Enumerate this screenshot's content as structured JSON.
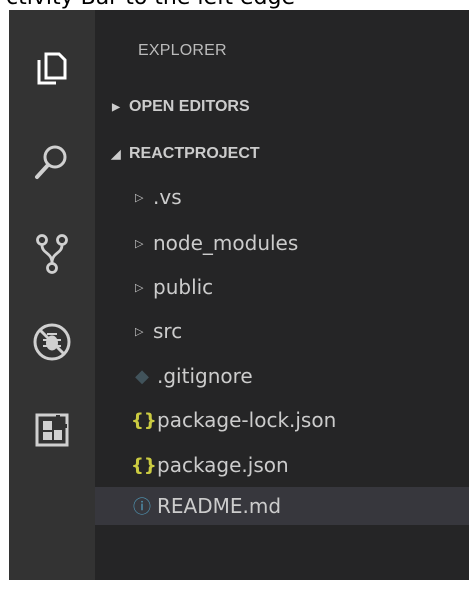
{
  "caption": "ctivity Bar to the left edge",
  "activity_bar": {
    "icons": [
      {
        "name": "explorer-icon"
      },
      {
        "name": "search-icon"
      },
      {
        "name": "source-control-icon"
      },
      {
        "name": "debug-icon"
      },
      {
        "name": "extensions-icon"
      }
    ]
  },
  "explorer": {
    "title": "EXPLORER",
    "sections": [
      {
        "label": "OPEN EDITORS",
        "expanded": false
      },
      {
        "label": "REACTPROJECT",
        "expanded": true
      }
    ],
    "items": [
      {
        "label": ".vs",
        "kind": "folder"
      },
      {
        "label": "node_modules",
        "kind": "folder"
      },
      {
        "label": "public",
        "kind": "folder"
      },
      {
        "label": "src",
        "kind": "folder"
      },
      {
        "label": ".gitignore",
        "kind": "git",
        "icon_glyph": "◆",
        "icon_color": "#41535b"
      },
      {
        "label": "package-lock.json",
        "kind": "json",
        "icon_glyph": "{}",
        "icon_color": "#cbcb41"
      },
      {
        "label": "package.json",
        "kind": "json",
        "icon_glyph": "{}",
        "icon_color": "#cbcb41"
      },
      {
        "label": "README.md",
        "kind": "info",
        "icon_glyph": "ⓘ",
        "icon_color": "#519aba",
        "selected": true
      }
    ]
  },
  "colors": {
    "activity_bar_bg": "#333333",
    "sidebar_bg": "#252526",
    "selected_bg": "#37373d",
    "text": "#cccccc"
  }
}
